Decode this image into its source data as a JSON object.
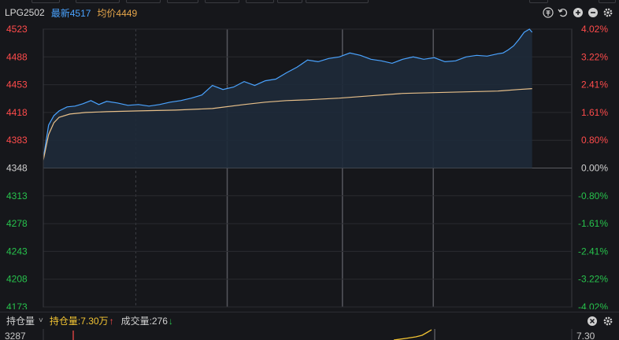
{
  "header": {
    "symbol": "LPG2502",
    "latest_text": "最新4517",
    "avg_text": "均价4449",
    "tools": [
      "coin-icon",
      "undo-icon",
      "zoom-in-icon",
      "zoom-out-icon",
      "settings-icon"
    ]
  },
  "chart_data": {
    "type": "line",
    "title": "",
    "xlabel": "",
    "ylabel": "",
    "y_ticks_left": [
      "4523",
      "4488",
      "4453",
      "4418",
      "4383",
      "4348",
      "4313",
      "4278",
      "4243",
      "4208",
      "4173"
    ],
    "y_ticks_right": [
      "4.02%",
      "3.22%",
      "2.41%",
      "1.61%",
      "0.80%",
      "0.00%",
      "-0.80%",
      "-1.61%",
      "-2.41%",
      "-3.22%",
      "-4.02%"
    ],
    "ylim": [
      4173,
      4523
    ],
    "x_fraction_range": [
      0,
      1
    ],
    "series": [
      {
        "name": "最新",
        "color": "#4aa3ff",
        "x": [
          0,
          0.01,
          0.02,
          0.03,
          0.045,
          0.06,
          0.075,
          0.09,
          0.105,
          0.12,
          0.14,
          0.16,
          0.18,
          0.2,
          0.22,
          0.24,
          0.26,
          0.28,
          0.3,
          0.32,
          0.34,
          0.36,
          0.38,
          0.4,
          0.42,
          0.44,
          0.46,
          0.48,
          0.5,
          0.52,
          0.54,
          0.56,
          0.58,
          0.6,
          0.62,
          0.64,
          0.66,
          0.68,
          0.7,
          0.72,
          0.74,
          0.76,
          0.78,
          0.8,
          0.82,
          0.84,
          0.86,
          0.87,
          0.88,
          0.89,
          0.9,
          0.91,
          0.92,
          0.925
        ],
        "y": [
          4360,
          4402,
          4414,
          4420,
          4425,
          4426,
          4429,
          4433,
          4428,
          4432,
          4430,
          4427,
          4428,
          4426,
          4428,
          4431,
          4433,
          4436,
          4440,
          4452,
          4447,
          4450,
          4457,
          4452,
          4458,
          4460,
          4468,
          4475,
          4484,
          4482,
          4486,
          4488,
          4493,
          4490,
          4485,
          4483,
          4480,
          4485,
          4488,
          4485,
          4487,
          4482,
          4483,
          4488,
          4490,
          4489,
          4492,
          4493,
          4497,
          4502,
          4510,
          4519,
          4523,
          4519
        ]
      },
      {
        "name": "均价",
        "color": "#e8c08a",
        "x": [
          0,
          0.01,
          0.02,
          0.03,
          0.05,
          0.08,
          0.12,
          0.18,
          0.25,
          0.32,
          0.38,
          0.42,
          0.46,
          0.5,
          0.56,
          0.62,
          0.68,
          0.74,
          0.8,
          0.86,
          0.9,
          0.925
        ],
        "y": [
          4358,
          4390,
          4405,
          4412,
          4416,
          4418,
          4419,
          4420,
          4421,
          4423,
          4428,
          4431,
          4433,
          4434,
          4436,
          4439,
          4442,
          4443,
          4444,
          4445,
          4447,
          4448
        ]
      }
    ],
    "grid": true,
    "legend": "none"
  },
  "sub_panel": {
    "selector_label": "持仓量",
    "selector_chevron": "˅",
    "oi_text": "持仓量:7.30万",
    "oi_arrow": "↑",
    "vol_text": "成交量:276",
    "vol_arrow": "↓",
    "left_value": "3287",
    "right_value": "7.30",
    "tools": [
      "close-icon",
      "settings-icon"
    ]
  },
  "colors": {
    "background": "#16171b",
    "up": "#ff4b4b",
    "down": "#27c24c",
    "neutral": "#d0d0d0",
    "price_line": "#4aa3ff",
    "avg_line": "#e8c08a"
  }
}
